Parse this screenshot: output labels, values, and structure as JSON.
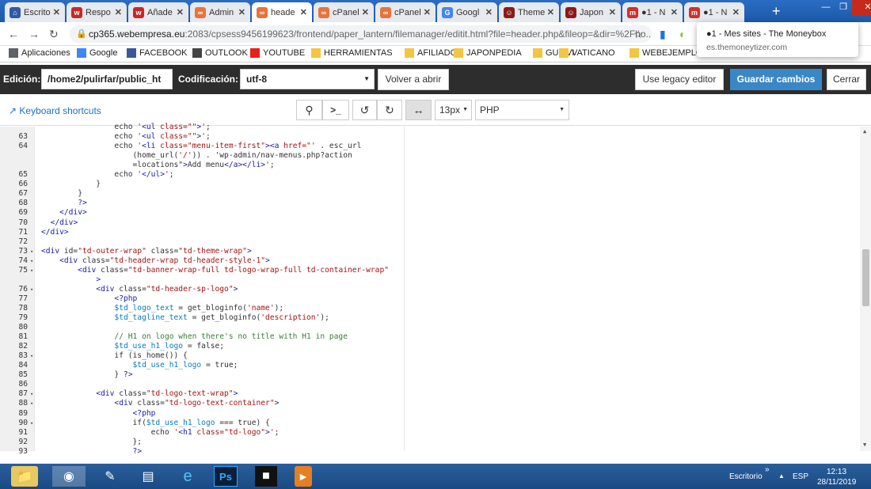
{
  "browser": {
    "tabs": [
      {
        "title": "Escrito",
        "color": "#2e5aa7",
        "glyph": "⌂",
        "active": false
      },
      {
        "title": "Respo",
        "color": "#c62828",
        "glyph": "w",
        "active": false
      },
      {
        "title": "Añade",
        "color": "#c62828",
        "glyph": "w",
        "active": false
      },
      {
        "title": "Admin",
        "color": "#e8733c",
        "glyph": "∞",
        "active": false
      },
      {
        "title": "heade",
        "color": "#e8733c",
        "glyph": "∞",
        "active": true
      },
      {
        "title": "cPanel",
        "color": "#e8733c",
        "glyph": "∞",
        "active": false
      },
      {
        "title": "cPanel",
        "color": "#e8733c",
        "glyph": "∞",
        "active": false
      },
      {
        "title": "Googl",
        "color": "#4285f4",
        "glyph": "G",
        "active": false
      },
      {
        "title": "Theme",
        "color": "#8b1a1a",
        "glyph": "☺",
        "active": false
      },
      {
        "title": "Japon",
        "color": "#8b1a1a",
        "glyph": "☺",
        "active": false
      },
      {
        "title": "●1 - N",
        "color": "#d32f2f",
        "glyph": "m",
        "active": false
      },
      {
        "title": "●1 - N",
        "color": "#d32f2f",
        "glyph": "m",
        "active": false
      }
    ],
    "new_tab": "+",
    "url_host": "cp365.webempresa.eu",
    "url_rest": ":2083/cpsess9456199623/frontend/paper_lantern/filemanager/editit.html?file=header.php&fileop=&dir=%2Fho...",
    "bookmarks": [
      {
        "label": "Aplicaciones",
        "color": "#5f6368"
      },
      {
        "label": "Google",
        "color": "#4285f4"
      },
      {
        "label": "FACEBOOK",
        "color": "#3b5998"
      },
      {
        "label": "OUTLOOK",
        "color": "#444444"
      },
      {
        "label": "YOUTUBE",
        "color": "#e62117"
      },
      {
        "label": "HERRAMIENTAS",
        "color": "#f4c542"
      },
      {
        "label": "AFILIADOS",
        "color": "#f4c542"
      },
      {
        "label": "JAPONPEDIA",
        "color": "#f4c542"
      },
      {
        "label": "GUIAVI",
        "color": "#f4c542"
      },
      {
        "label": "VATICANO",
        "color": "#f4c542"
      },
      {
        "label": "WEBEJEMPLO",
        "color": "#f4c542"
      }
    ],
    "notification": {
      "title": "●1 - Mes sites - The Moneybox",
      "subtitle": "es.themoneytizer.com"
    }
  },
  "toolbar": {
    "edit_label": "Edición:",
    "path_value": "/home2/pulirfar/public_ht",
    "encoding_label": "Codificación:",
    "encoding_value": "utf-8",
    "reopen_label": "Volver a abrir",
    "legacy_label": "Use legacy editor",
    "save_label": "Guardar cambios",
    "close_label": "Cerrar"
  },
  "subbar": {
    "shortcuts_label": "Keyboard shortcuts",
    "font_size": "13px",
    "language": "PHP"
  },
  "editor": {
    "lines": [
      {
        "n": "",
        "t": "                echo '<ul class=\"\">';",
        "row": 0
      },
      {
        "n": "63",
        "t": "                echo '<ul class=\"\">';",
        "row": 1
      },
      {
        "n": "64",
        "t": "                echo '<li class=\"menu-item-first\"><a href=\"' . esc_url",
        "row": 2
      },
      {
        "n": "",
        "t": "                    (home_url('/')) . 'wp-admin/nav-menus.php?action",
        "row": 3
      },
      {
        "n": "",
        "t": "                    =locations\">Add menu</a></li>';",
        "row": 4
      },
      {
        "n": "65",
        "t": "                echo '</ul>';",
        "row": 5
      },
      {
        "n": "66",
        "t": "            }",
        "row": 6
      },
      {
        "n": "67",
        "t": "        }",
        "row": 7
      },
      {
        "n": "68",
        "t": "        ?>",
        "row": 8
      },
      {
        "n": "69",
        "t": "    </div>",
        "row": 9
      },
      {
        "n": "70",
        "t": "  </div>",
        "row": 10
      },
      {
        "n": "71",
        "t": "</div>",
        "row": 11
      },
      {
        "n": "72",
        "t": "",
        "row": 12
      },
      {
        "n": "73",
        "t": "<div id=\"td-outer-wrap\" class=\"td-theme-wrap\">",
        "row": 13
      },
      {
        "n": "74",
        "t": "    <div class=\"td-header-wrap td-header-style-1\">",
        "row": 14
      },
      {
        "n": "75",
        "t": "        <div class=\"td-banner-wrap-full td-logo-wrap-full td-container-wrap\"",
        "row": 15
      },
      {
        "n": "",
        "t": "            >",
        "row": 16
      },
      {
        "n": "76",
        "t": "            <div class=\"td-header-sp-logo\">",
        "row": 17
      },
      {
        "n": "77",
        "t": "                <?php",
        "row": 18
      },
      {
        "n": "78",
        "t": "                $td_logo_text = get_bloginfo('name');",
        "row": 19
      },
      {
        "n": "79",
        "t": "                $td_tagline_text = get_bloginfo('description');",
        "row": 20
      },
      {
        "n": "80",
        "t": "",
        "row": 21
      },
      {
        "n": "81",
        "t": "                // H1 on logo when there's no title with H1 in page",
        "row": 22
      },
      {
        "n": "82",
        "t": "                $td_use_h1_logo = false;",
        "row": 23
      },
      {
        "n": "83",
        "t": "                if (is_home()) {",
        "row": 24
      },
      {
        "n": "84",
        "t": "                    $td_use_h1_logo = true;",
        "row": 25
      },
      {
        "n": "85",
        "t": "                } ?>",
        "row": 26
      },
      {
        "n": "86",
        "t": "",
        "row": 27
      },
      {
        "n": "87",
        "t": "            <div class=\"td-logo-text-wrap\">",
        "row": 28
      },
      {
        "n": "88",
        "t": "                <div class=\"td-logo-text-container\">",
        "row": 29
      },
      {
        "n": "89",
        "t": "                    <?php",
        "row": 30
      },
      {
        "n": "90",
        "t": "                    if($td_use_h1_logo === true) {",
        "row": 31
      },
      {
        "n": "91",
        "t": "                        echo '<h1 class=\"td-logo\">';",
        "row": 32
      },
      {
        "n": "92",
        "t": "                    };",
        "row": 33
      },
      {
        "n": "93",
        "t": "                    ?>",
        "row": 34
      }
    ],
    "fold_lines": [
      "73",
      "74",
      "75",
      "76",
      "83",
      "87",
      "88",
      "90"
    ]
  },
  "taskbar": {
    "desktop_label": "Escritorio",
    "lang": "ESP",
    "time": "12:13",
    "date": "28/11/2019"
  }
}
